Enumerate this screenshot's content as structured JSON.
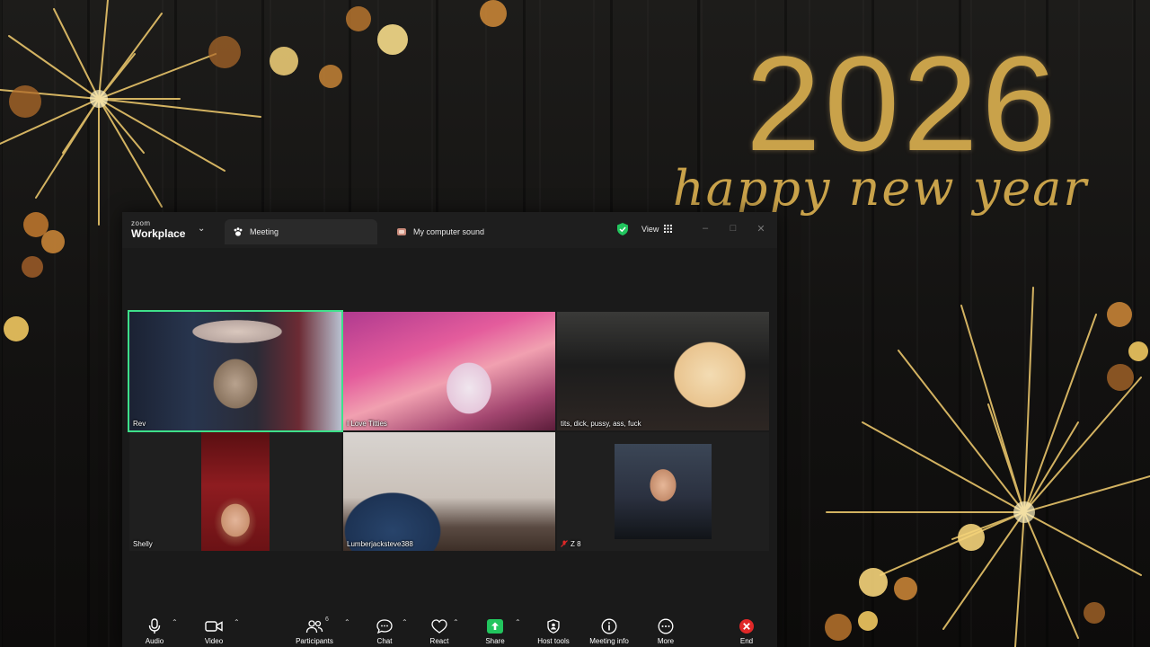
{
  "wallpaper": {
    "year": "2026",
    "greeting": "happy new year",
    "accent": "#c9a24a"
  },
  "app": {
    "brand_small": "zoom",
    "brand_big": "Workplace",
    "tabs": [
      {
        "label": "Meeting",
        "icon": "paw-icon"
      },
      {
        "label": "My computer sound",
        "icon": "computer-sound-icon"
      }
    ],
    "view_label": "View"
  },
  "participants": [
    {
      "name": "Rev",
      "active_speaker": true
    },
    {
      "name": "I Love Titties"
    },
    {
      "name": "tits, dick, pussy, ass, fuck"
    },
    {
      "name": "Shelly"
    },
    {
      "name": "Lumberjacksteve388"
    },
    {
      "name": "Z 8",
      "muted": true
    }
  ],
  "toolbar": {
    "audio": "Audio",
    "video": "Video",
    "participants": "Participants",
    "participants_count": "6",
    "chat": "Chat",
    "react": "React",
    "share": "Share",
    "host_tools": "Host tools",
    "meeting_info": "Meeting info",
    "more": "More",
    "end": "End",
    "share_color": "#22c55e",
    "end_color": "#e02828"
  }
}
